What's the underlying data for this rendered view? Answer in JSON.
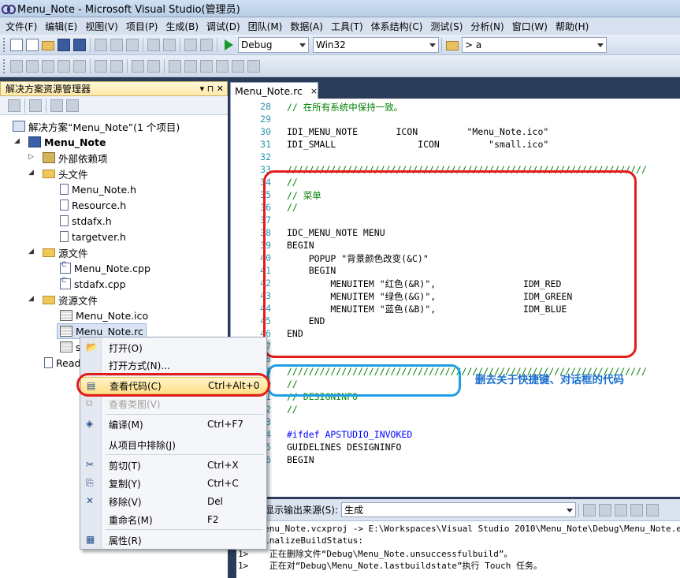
{
  "window": {
    "title": "Menu_Note - Microsoft Visual Studio(管理员)"
  },
  "menu": [
    "文件(F)",
    "编辑(E)",
    "视图(V)",
    "项目(P)",
    "生成(B)",
    "调试(D)",
    "团队(M)",
    "数据(A)",
    "工具(T)",
    "体系结构(C)",
    "测试(S)",
    "分析(N)",
    "窗口(W)",
    "帮助(H)"
  ],
  "toolbar": {
    "config": "Debug",
    "platform": "Win32",
    "find": "> a"
  },
  "solution_explorer": {
    "title": "解决方案资源管理器",
    "controls": "▾ ⊓ ✕",
    "solution": "解决方案“Menu_Note”(1 个项目)",
    "project": "Menu_Note",
    "external": "外部依赖项",
    "headers_folder": "头文件",
    "headers": [
      "Menu_Note.h",
      "Resource.h",
      "stdafx.h",
      "targetver.h"
    ],
    "sources_folder": "源文件",
    "sources": [
      "Menu_Note.cpp",
      "stdafx.cpp"
    ],
    "resources_folder": "资源文件",
    "resources": [
      "Menu_Note.ico",
      "Menu_Note.rc",
      "s"
    ],
    "readme": "Read"
  },
  "editor": {
    "tab": "Menu_Note.rc",
    "tab_close": "×",
    "lines": [
      {
        "n": "28",
        "t": "// 在所有系统中保持一致。",
        "c": "cm"
      },
      {
        "n": "29",
        "t": "",
        "c": ""
      },
      {
        "n": "30",
        "t": "IDI_MENU_NOTE       ICON         \"Menu_Note.ico\"",
        "c": ""
      },
      {
        "n": "31",
        "t": "IDI_SMALL               ICON         \"small.ico\"",
        "c": ""
      },
      {
        "n": "32",
        "t": "",
        "c": ""
      },
      {
        "n": "33",
        "t": "//////////////////////////////////////////////////////////////////",
        "c": "cm"
      },
      {
        "n": "34",
        "t": "//",
        "c": "cm"
      },
      {
        "n": "35",
        "t": "// 菜单",
        "c": "cm"
      },
      {
        "n": "36",
        "t": "//",
        "c": "cm"
      },
      {
        "n": "37",
        "t": "",
        "c": ""
      },
      {
        "n": "38",
        "t": "IDC_MENU_NOTE MENU",
        "c": ""
      },
      {
        "n": "39",
        "t": "BEGIN",
        "c": ""
      },
      {
        "n": "40",
        "t": "    POPUP \"背景颜色改变(&C)\"",
        "c": ""
      },
      {
        "n": "41",
        "t": "    BEGIN",
        "c": ""
      },
      {
        "n": "42",
        "t": "        MENUITEM \"红色(&R)\",                IDM_RED",
        "c": ""
      },
      {
        "n": "43",
        "t": "        MENUITEM \"绿色(&G)\",                IDM_GREEN",
        "c": ""
      },
      {
        "n": "44",
        "t": "        MENUITEM \"蓝色(&B)\",                IDM_BLUE",
        "c": ""
      },
      {
        "n": "45",
        "t": "    END",
        "c": ""
      },
      {
        "n": "46",
        "t": "END",
        "c": ""
      },
      {
        "n": "47",
        "t": "",
        "c": ""
      },
      {
        "n": "48",
        "t": "",
        "c": ""
      },
      {
        "n": "49",
        "t": "//////////////////////////////////////////////////////////////////",
        "c": "cm"
      },
      {
        "n": "50",
        "t": "//",
        "c": "cm"
      },
      {
        "n": "51",
        "t": "// DESIGNINFO",
        "c": "cm"
      },
      {
        "n": "52",
        "t": "//",
        "c": "cm"
      },
      {
        "n": "53",
        "t": "",
        "c": ""
      },
      {
        "n": "54",
        "t": "#ifdef APSTUDIO_INVOKED",
        "c": "kw"
      },
      {
        "n": "55",
        "t": "GUIDELINES DESIGNINFO",
        "c": ""
      },
      {
        "n": "56",
        "t": "BEGIN",
        "c": ""
      }
    ],
    "annotation": "删去关于快捷键、对话框的代码"
  },
  "output": {
    "source_label": "显示输出来源(S):",
    "source_value": "生成",
    "lines": [
      "    Menu_Note.vcxproj -> E:\\Workspaces\\Visual Studio 2010\\Menu_Note\\Debug\\Menu_Note.exe",
      "    FinalizeBuildStatus:",
      "1>    正在删除文件“Debug\\Menu_Note.unsuccessfulbuild”。",
      "1>    正在对“Debug\\Menu_Note.lastbuildstate”执行 Touch 任务。"
    ]
  },
  "context_menu": [
    {
      "label": "打开(O)",
      "shortcut": "",
      "icon": "open-icon",
      "disabled": false,
      "highlight": false
    },
    {
      "label": "打开方式(N)...",
      "shortcut": "",
      "icon": "",
      "disabled": false,
      "highlight": false
    },
    {
      "label": "查看代码(C)",
      "shortcut": "Ctrl+Alt+0",
      "icon": "view-code-icon",
      "disabled": false,
      "highlight": true
    },
    {
      "label": "查看类图(V)",
      "shortcut": "",
      "icon": "class-diagram-icon",
      "disabled": true,
      "highlight": false
    },
    {
      "label": "编译(M)",
      "shortcut": "Ctrl+F7",
      "icon": "compile-icon",
      "disabled": false,
      "highlight": false
    },
    {
      "label": "从项目中排除(J)",
      "shortcut": "",
      "icon": "",
      "disabled": false,
      "highlight": false
    },
    {
      "label": "剪切(T)",
      "shortcut": "Ctrl+X",
      "icon": "cut-icon",
      "disabled": false,
      "highlight": false
    },
    {
      "label": "复制(Y)",
      "shortcut": "Ctrl+C",
      "icon": "copy-icon",
      "disabled": false,
      "highlight": false
    },
    {
      "label": "移除(V)",
      "shortcut": "Del",
      "icon": "remove-icon",
      "disabled": false,
      "highlight": false
    },
    {
      "label": "重命名(M)",
      "shortcut": "F2",
      "icon": "",
      "disabled": false,
      "highlight": false
    },
    {
      "label": "属性(R)",
      "shortcut": "",
      "icon": "properties-icon",
      "disabled": false,
      "highlight": false
    }
  ]
}
